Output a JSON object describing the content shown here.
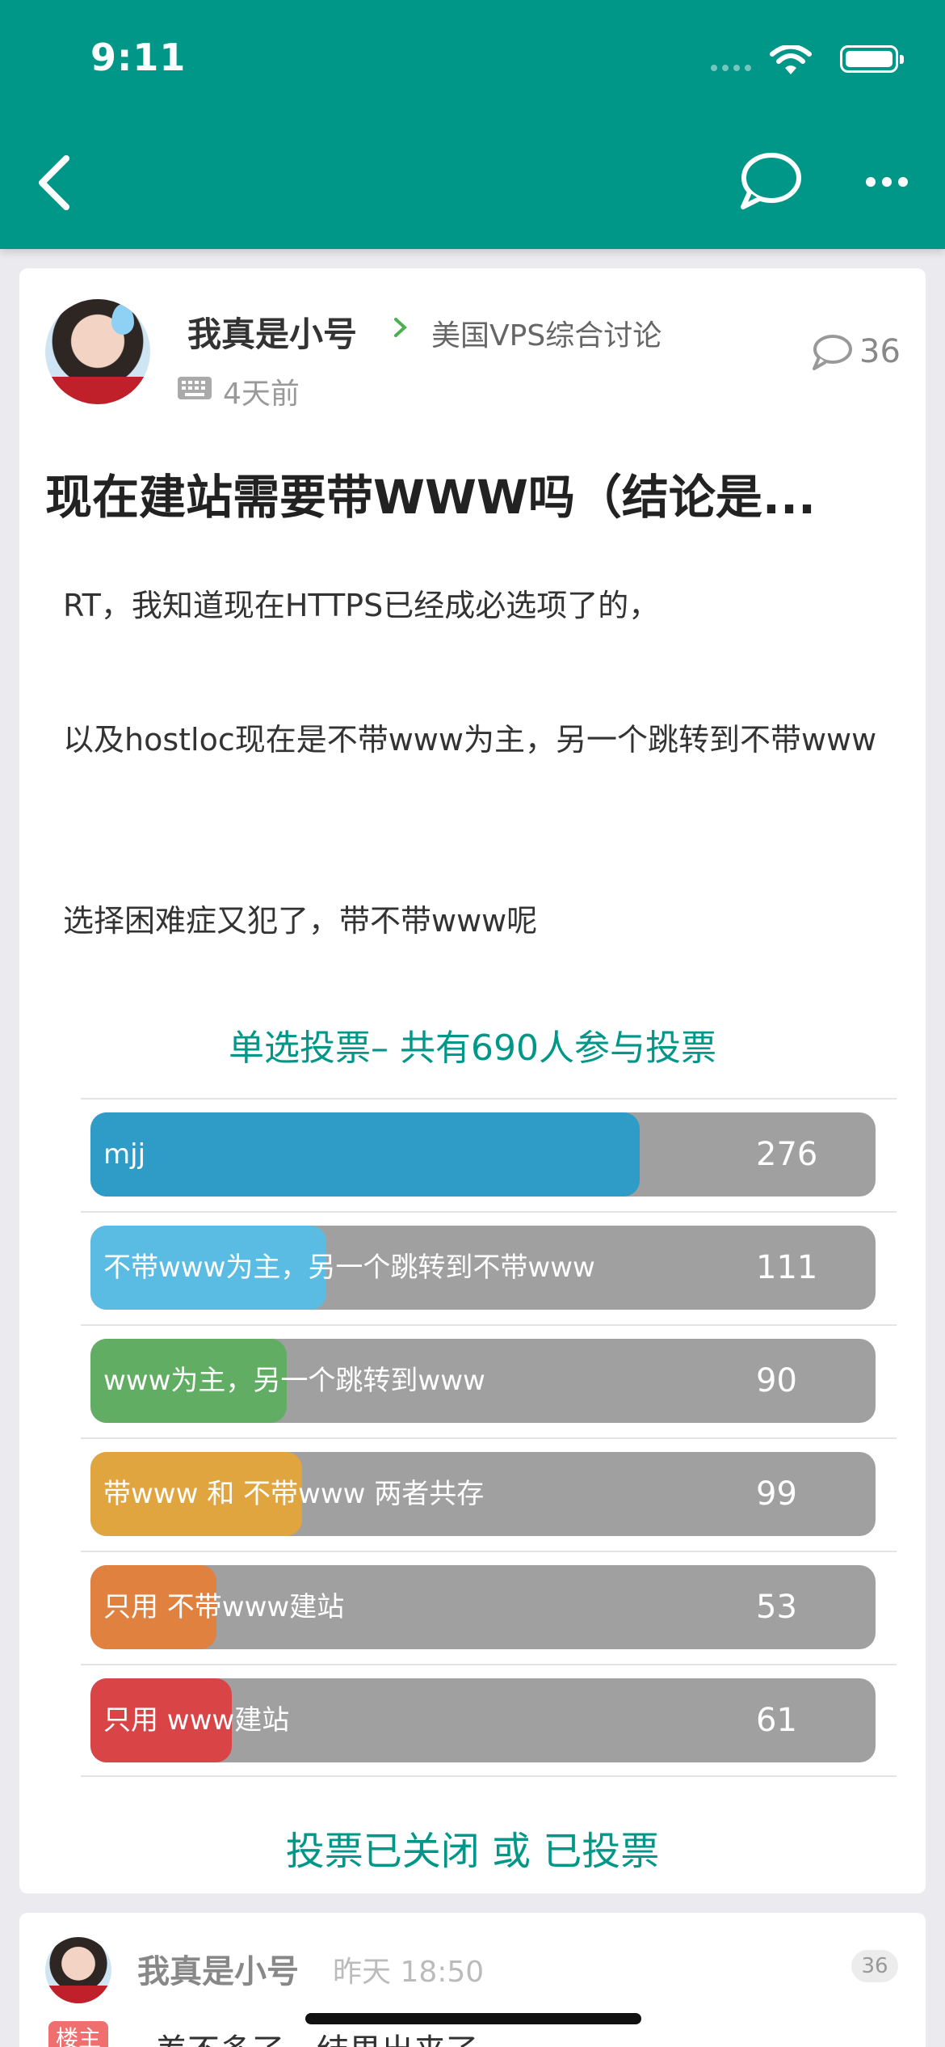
{
  "status_bar": {
    "time": "9:11"
  },
  "post": {
    "author": "我真是小号",
    "forum": "美国VPS综合讨论",
    "time_ago": "4天前",
    "reply_count": "36",
    "title": "现在建站需要带WWW吗（结论是...",
    "paragraphs": [
      "RT，我知道现在HTTPS已经成必选项了的，",
      "以及hostloc现在是不带www为主，另一个跳转到不带www",
      "选择困难症又犯了，带不带www呢"
    ]
  },
  "poll": {
    "title": "单选投票– 共有690人参与投票",
    "status": "投票已关闭 或 已投票",
    "options": [
      {
        "label": "mjj",
        "count": "276",
        "fill": 0.7,
        "color": "#2f9bc7"
      },
      {
        "label": "不带www为主，另一个跳转到不带www",
        "count": "111",
        "fill": 0.3,
        "color": "#5bbce3"
      },
      {
        "label": "www为主，另一个跳转到www",
        "count": "90",
        "fill": 0.25,
        "color": "#62ad64"
      },
      {
        "label": "带www 和 不带www 两者共存",
        "count": "99",
        "fill": 0.27,
        "color": "#e0a53e"
      },
      {
        "label": "只用 不带www建站",
        "count": "53",
        "fill": 0.16,
        "color": "#e0813f"
      },
      {
        "label": "只用 www建站",
        "count": "61",
        "fill": 0.18,
        "color": "#d94446"
      }
    ]
  },
  "reply": {
    "author": "我真是小号",
    "time": "昨天 18:50",
    "floor_badge": "36",
    "op_badge": "楼主",
    "text": "差不多了，结果出来了"
  },
  "icons": {
    "back": "chevron-left-icon",
    "comment": "chat-bubble-icon",
    "more": "more-horizontal-icon",
    "keyboard": "keyboard-icon",
    "reply": "comment-icon"
  },
  "colors": {
    "primary": "#009688"
  }
}
